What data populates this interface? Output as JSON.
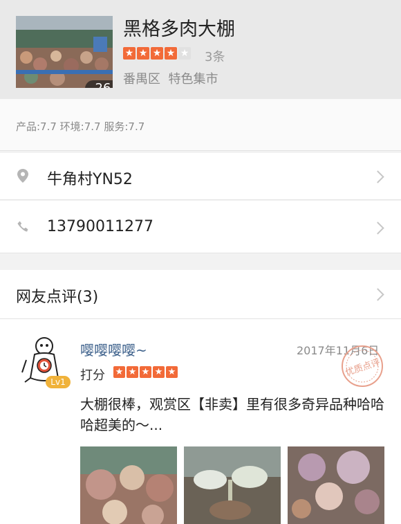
{
  "shop": {
    "name": "黑格多肉大棚",
    "photo_count": "26",
    "rating_stars": 4,
    "review_count_label": "3条",
    "area": "番禺区",
    "category": "特色集市",
    "scores": "产品:7.7 环境:7.7 服务:7.7"
  },
  "address": {
    "icon": "location-pin-icon",
    "text": "牛角村YN52"
  },
  "phone": {
    "icon": "phone-icon",
    "text": "13790011277"
  },
  "reviews_header": {
    "label": "网友点评(3)"
  },
  "review": {
    "user": "嘤嘤嘤嘤~",
    "level": "Lv1",
    "date": "2017年11月6日",
    "rating_label": "打分",
    "rating_stars": 5,
    "stamp_text": "优质点评",
    "body": "大棚很棒，观赏区【非卖】里有很多奇异品种哈哈哈超美的～..."
  },
  "colors": {
    "accent": "#f26a38",
    "link": "#3b5f8a",
    "stamp": "#e8a08c"
  }
}
